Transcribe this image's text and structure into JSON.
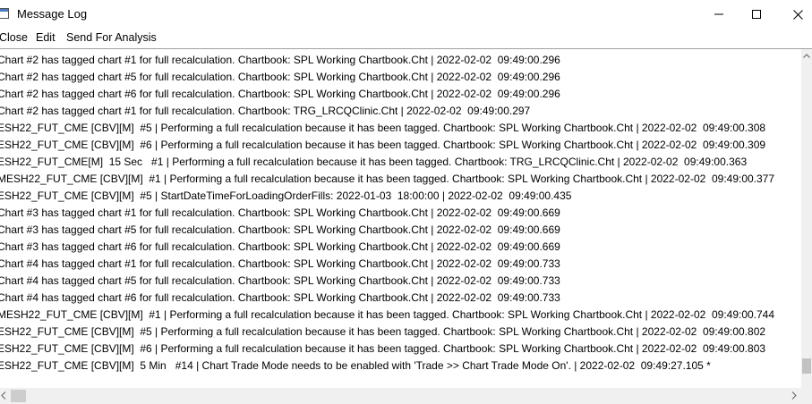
{
  "window": {
    "title": "Message Log",
    "app_icon": "window-icon",
    "minimize_icon": "minimize-icon",
    "maximize_icon": "maximize-icon",
    "close_icon": "close-icon"
  },
  "menu": {
    "items": [
      {
        "label": "Close"
      },
      {
        "label": "Edit"
      },
      {
        "label": "Send For Analysis"
      }
    ]
  },
  "log": {
    "lines": [
      "Chart #2 has tagged chart #1 for full recalculation. Chartbook: SPL Working Chartbook.Cht | 2022-02-02  09:49:00.296",
      "Chart #2 has tagged chart #5 for full recalculation. Chartbook: SPL Working Chartbook.Cht | 2022-02-02  09:49:00.296",
      "Chart #2 has tagged chart #6 for full recalculation. Chartbook: SPL Working Chartbook.Cht | 2022-02-02  09:49:00.296",
      "Chart #2 has tagged chart #1 for full recalculation. Chartbook: TRG_LRCQClinic.Cht | 2022-02-02  09:49:00.297",
      "ESH22_FUT_CME [CBV][M]  #5 | Performing a full recalculation because it has been tagged. Chartbook: SPL Working Chartbook.Cht | 2022-02-02  09:49:00.308",
      "ESH22_FUT_CME [CBV][M]  #6 | Performing a full recalculation because it has been tagged. Chartbook: SPL Working Chartbook.Cht | 2022-02-02  09:49:00.309",
      "ESH22_FUT_CME[M]  15 Sec   #1 | Performing a full recalculation because it has been tagged. Chartbook: TRG_LRCQClinic.Cht | 2022-02-02  09:49:00.363",
      "MESH22_FUT_CME [CBV][M]  #1 | Performing a full recalculation because it has been tagged. Chartbook: SPL Working Chartbook.Cht | 2022-02-02  09:49:00.377",
      "ESH22_FUT_CME [CBV][M]  #5 | StartDateTimeForLoadingOrderFills: 2022-01-03  18:00:00 | 2022-02-02  09:49:00.435",
      "Chart #3 has tagged chart #1 for full recalculation. Chartbook: SPL Working Chartbook.Cht | 2022-02-02  09:49:00.669",
      "Chart #3 has tagged chart #5 for full recalculation. Chartbook: SPL Working Chartbook.Cht | 2022-02-02  09:49:00.669",
      "Chart #3 has tagged chart #6 for full recalculation. Chartbook: SPL Working Chartbook.Cht | 2022-02-02  09:49:00.669",
      "Chart #4 has tagged chart #1 for full recalculation. Chartbook: SPL Working Chartbook.Cht | 2022-02-02  09:49:00.733",
      "Chart #4 has tagged chart #5 for full recalculation. Chartbook: SPL Working Chartbook.Cht | 2022-02-02  09:49:00.733",
      "Chart #4 has tagged chart #6 for full recalculation. Chartbook: SPL Working Chartbook.Cht | 2022-02-02  09:49:00.733",
      "MESH22_FUT_CME [CBV][M]  #1 | Performing a full recalculation because it has been tagged. Chartbook: SPL Working Chartbook.Cht | 2022-02-02  09:49:00.744",
      "ESH22_FUT_CME [CBV][M]  #5 | Performing a full recalculation because it has been tagged. Chartbook: SPL Working Chartbook.Cht | 2022-02-02  09:49:00.802",
      "ESH22_FUT_CME [CBV][M]  #6 | Performing a full recalculation because it has been tagged. Chartbook: SPL Working Chartbook.Cht | 2022-02-02  09:49:00.803",
      "ESH22_FUT_CME [CBV][M]  5 Min   #14 | Chart Trade Mode needs to be enabled with 'Trade >> Chart Trade Mode On'. | 2022-02-02  09:49:27.105 *"
    ]
  },
  "scrollbars": {
    "up_icon": "chevron-up-icon",
    "left_icon": "chevron-left-icon",
    "right_icon": "chevron-right-icon"
  }
}
